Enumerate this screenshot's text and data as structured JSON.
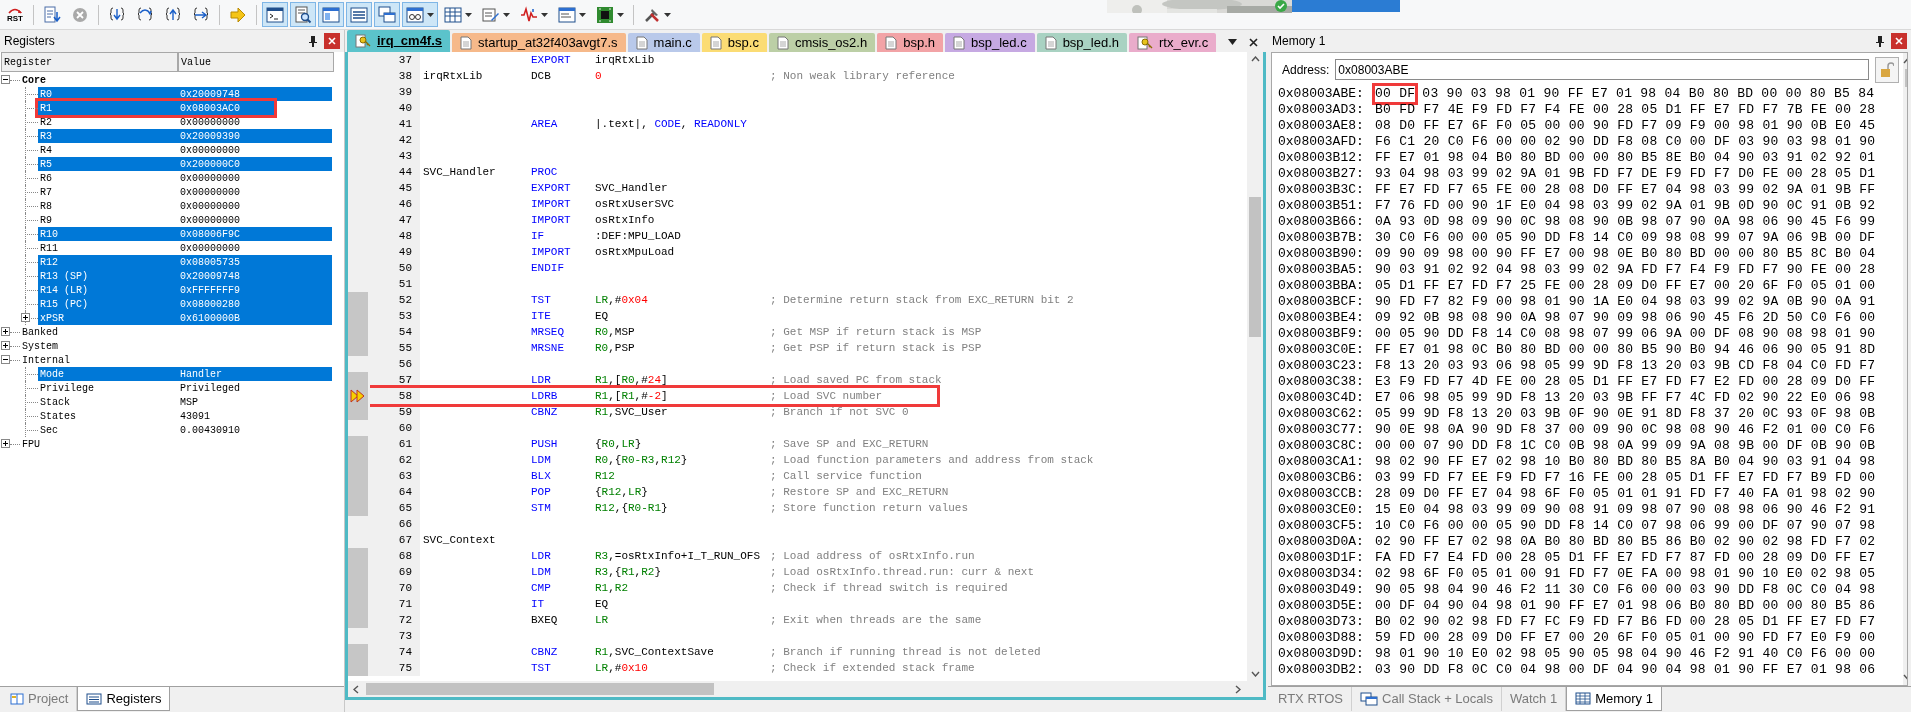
{
  "toolbar": [
    {
      "kind": "reset",
      "label": "RST",
      "on": false,
      "dropdown": false
    },
    {
      "kind": "separator"
    },
    {
      "kind": "run",
      "on": false,
      "dropdown": false
    },
    {
      "kind": "stop",
      "on": false,
      "dropdown": false
    },
    {
      "kind": "separator"
    },
    {
      "kind": "step-in",
      "on": false,
      "dropdown": false
    },
    {
      "kind": "step-over",
      "on": false,
      "dropdown": false
    },
    {
      "kind": "step-out",
      "on": false,
      "dropdown": false
    },
    {
      "kind": "run-to-cursor",
      "on": false,
      "dropdown": false
    },
    {
      "kind": "separator"
    },
    {
      "kind": "show-next",
      "on": false,
      "dropdown": false
    },
    {
      "kind": "separator"
    },
    {
      "kind": "command",
      "on": true,
      "dropdown": false
    },
    {
      "kind": "disassembly",
      "on": true,
      "dropdown": false
    },
    {
      "kind": "symbols",
      "on": true,
      "dropdown": false
    },
    {
      "kind": "registers",
      "on": true,
      "dropdown": false
    },
    {
      "kind": "call-stack",
      "on": true,
      "dropdown": false
    },
    {
      "kind": "watch",
      "on": true,
      "dropdown": true
    },
    {
      "kind": "memory",
      "on": false,
      "dropdown": true
    },
    {
      "kind": "serial",
      "on": false,
      "dropdown": true
    },
    {
      "kind": "analysis",
      "on": false,
      "dropdown": true
    },
    {
      "kind": "trace",
      "on": false,
      "dropdown": true
    },
    {
      "kind": "system-viewer",
      "on": false,
      "dropdown": true
    },
    {
      "kind": "separator"
    },
    {
      "kind": "toolbox",
      "on": false,
      "dropdown": true
    }
  ],
  "registers": {
    "title": "Registers",
    "columns": [
      "Register",
      "Value"
    ],
    "tree": [
      {
        "name": "Core",
        "expanded": true,
        "emphasized": true,
        "children": [
          {
            "name": "R0",
            "value": "0x20009748",
            "changed": true,
            "framed": false
          },
          {
            "name": "R1",
            "value": "0x08003AC0",
            "changed": true,
            "framed": true
          },
          {
            "name": "R2",
            "value": "0x00000000",
            "changed": false,
            "framed": false
          },
          {
            "name": "R3",
            "value": "0x20009390",
            "changed": true,
            "framed": false
          },
          {
            "name": "R4",
            "value": "0x00000000",
            "changed": false,
            "framed": false
          },
          {
            "name": "R5",
            "value": "0x200000C0",
            "changed": true,
            "framed": false
          },
          {
            "name": "R6",
            "value": "0x00000000",
            "changed": false,
            "framed": false
          },
          {
            "name": "R7",
            "value": "0x00000000",
            "changed": false,
            "framed": false
          },
          {
            "name": "R8",
            "value": "0x00000000",
            "changed": false,
            "framed": false
          },
          {
            "name": "R9",
            "value": "0x00000000",
            "changed": false,
            "framed": false
          },
          {
            "name": "R10",
            "value": "0x08006F9C",
            "changed": true,
            "framed": false
          },
          {
            "name": "R11",
            "value": "0x00000000",
            "changed": false,
            "framed": false
          },
          {
            "name": "R12",
            "value": "0x08005735",
            "changed": true,
            "framed": false
          },
          {
            "name": "R13 (SP)",
            "value": "0x20009748",
            "changed": true,
            "framed": false
          },
          {
            "name": "R14 (LR)",
            "value": "0xFFFFFFF9",
            "changed": true,
            "framed": false
          },
          {
            "name": "R15 (PC)",
            "value": "0x08000280",
            "changed": true,
            "framed": false
          },
          {
            "name": "xPSR",
            "value": "0x6100000B",
            "changed": true,
            "framed": false,
            "expanded": false
          }
        ]
      },
      {
        "name": "Banked",
        "expanded": false,
        "emphasized": false
      },
      {
        "name": "System",
        "expanded": false,
        "emphasized": false
      },
      {
        "name": "Internal",
        "expanded": true,
        "emphasized": false,
        "children": [
          {
            "name": "Mode",
            "value": "Handler",
            "changed": true,
            "framed": false
          },
          {
            "name": "Privilege",
            "value": "Privileged",
            "changed": false,
            "framed": false
          },
          {
            "name": "Stack",
            "value": "MSP",
            "changed": false,
            "framed": false
          },
          {
            "name": "States",
            "value": "43091",
            "changed": false,
            "framed": false
          },
          {
            "name": "Sec",
            "value": "0.00430910",
            "changed": false,
            "framed": false
          }
        ]
      },
      {
        "name": "FPU",
        "expanded": false,
        "emphasized": false
      }
    ],
    "tabs": [
      {
        "label": "Project",
        "kind": "book",
        "selected": false
      },
      {
        "label": "Registers",
        "kind": "list",
        "selected": true
      }
    ]
  },
  "editor": {
    "tabs": [
      {
        "label": "irq_cm4f.s",
        "kind": "key",
        "color": "#5bc3cb",
        "selected": true
      },
      {
        "label": "startup_at32f403avgt7.s",
        "kind": "doc",
        "color": "#f6b98a",
        "selected": false
      },
      {
        "label": "main.c",
        "kind": "doc",
        "color": "#b9c9ea",
        "selected": false
      },
      {
        "label": "bsp.c",
        "kind": "doc",
        "color": "#fbdc74",
        "selected": false
      },
      {
        "label": "cmsis_os2.h",
        "kind": "doc",
        "color": "#bccfa6",
        "selected": false
      },
      {
        "label": "bsp.h",
        "kind": "doc",
        "color": "#f2a3a6",
        "selected": false
      },
      {
        "label": "bsp_led.c",
        "kind": "doc",
        "color": "#c6a9e2",
        "selected": false
      },
      {
        "label": "bsp_led.h",
        "kind": "doc",
        "color": "#a9d2c2",
        "selected": false
      },
      {
        "label": "rtx_evr.c",
        "kind": "key",
        "color": "#eaaccb",
        "selected": false
      }
    ],
    "lines": [
      {
        "n": "37",
        "op": "EXPORT",
        "op_kw": true,
        "args": [
          {
            "t": "irqRtxLib",
            "kind": "plain"
          }
        ],
        "executable": false,
        "current": false,
        "framed": false
      },
      {
        "n": "38",
        "label": "irqRtxLib",
        "op": "DCB",
        "op_kw": false,
        "args": [
          {
            "t": "0",
            "kind": "num"
          }
        ],
        "comment": "; Non weak library reference",
        "executable": false,
        "current": false,
        "framed": false
      },
      {
        "n": "39",
        "executable": false,
        "current": false,
        "framed": false
      },
      {
        "n": "40",
        "executable": false,
        "current": false,
        "framed": false
      },
      {
        "n": "41",
        "op": "AREA",
        "op_kw": true,
        "args": [
          {
            "t": "|.text|, ",
            "kind": "plain"
          },
          {
            "t": "CODE",
            "kind": "kw"
          },
          {
            "t": ", ",
            "kind": "plain"
          },
          {
            "t": "READONLY",
            "kind": "kw"
          }
        ],
        "executable": false,
        "current": false,
        "framed": false
      },
      {
        "n": "42",
        "executable": false,
        "current": false,
        "framed": false
      },
      {
        "n": "43",
        "executable": false,
        "current": false,
        "framed": false
      },
      {
        "n": "44",
        "label": "SVC_Handler",
        "op": "PROC",
        "op_kw": true,
        "executable": false,
        "current": false,
        "framed": false
      },
      {
        "n": "45",
        "op": "EXPORT",
        "op_kw": true,
        "args": [
          {
            "t": "SVC_Handler",
            "kind": "plain"
          }
        ],
        "executable": false,
        "current": false,
        "framed": false
      },
      {
        "n": "46",
        "op": "IMPORT",
        "op_kw": true,
        "args": [
          {
            "t": "osRtxUserSVC",
            "kind": "plain"
          }
        ],
        "executable": false,
        "current": false,
        "framed": false
      },
      {
        "n": "47",
        "op": "IMPORT",
        "op_kw": true,
        "args": [
          {
            "t": "osRtxInfo",
            "kind": "plain"
          }
        ],
        "executable": false,
        "current": false,
        "framed": false
      },
      {
        "n": "48",
        "op": "IF",
        "op_kw": true,
        "args": [
          {
            "t": ":DEF:MPU_LOAD",
            "kind": "plain"
          }
        ],
        "executable": false,
        "current": false,
        "framed": false
      },
      {
        "n": "49",
        "op": "IMPORT",
        "op_kw": true,
        "args": [
          {
            "t": "osRtxMpuLoad",
            "kind": "plain"
          }
        ],
        "executable": false,
        "current": false,
        "framed": false
      },
      {
        "n": "50",
        "op": "ENDIF",
        "op_kw": true,
        "executable": false,
        "current": false,
        "framed": false
      },
      {
        "n": "51",
        "executable": false,
        "current": false,
        "framed": false
      },
      {
        "n": "52",
        "op": "TST",
        "op_kw": true,
        "args": [
          {
            "t": "LR",
            "kind": "reg"
          },
          {
            "t": ",#",
            "kind": "plain"
          },
          {
            "t": "0x04",
            "kind": "num"
          }
        ],
        "comment": "; Determine return stack from EXC_RETURN bit 2",
        "executable": true,
        "current": false,
        "framed": false
      },
      {
        "n": "53",
        "op": "ITE",
        "op_kw": true,
        "args": [
          {
            "t": "EQ",
            "kind": "plain"
          }
        ],
        "executable": true,
        "current": false,
        "framed": false
      },
      {
        "n": "54",
        "op": "MRSEQ",
        "op_kw": true,
        "args": [
          {
            "t": "R0",
            "kind": "reg"
          },
          {
            "t": ",MSP",
            "kind": "plain"
          }
        ],
        "comment": "; Get MSP if return stack is MSP",
        "executable": true,
        "current": false,
        "framed": false
      },
      {
        "n": "55",
        "op": "MRSNE",
        "op_kw": true,
        "args": [
          {
            "t": "R0",
            "kind": "reg"
          },
          {
            "t": ",PSP",
            "kind": "plain"
          }
        ],
        "comment": "; Get PSP if return stack is PSP",
        "executable": true,
        "current": false,
        "framed": false
      },
      {
        "n": "56",
        "executable": false,
        "current": false,
        "framed": false
      },
      {
        "n": "57",
        "op": "LDR",
        "op_kw": true,
        "args": [
          {
            "t": "R1",
            "kind": "reg"
          },
          {
            "t": ",[",
            "kind": "plain"
          },
          {
            "t": "R0",
            "kind": "reg"
          },
          {
            "t": ",#",
            "kind": "plain"
          },
          {
            "t": "24",
            "kind": "num"
          },
          {
            "t": "]",
            "kind": "plain"
          }
        ],
        "comment": "; Load saved PC from stack",
        "executable": true,
        "current": false,
        "framed": false
      },
      {
        "n": "58",
        "op": "LDRB",
        "op_kw": true,
        "args": [
          {
            "t": "R1",
            "kind": "reg"
          },
          {
            "t": ",[",
            "kind": "plain"
          },
          {
            "t": "R1",
            "kind": "reg"
          },
          {
            "t": ",#",
            "kind": "plain"
          },
          {
            "t": "-2",
            "kind": "num"
          },
          {
            "t": "]",
            "kind": "plain"
          }
        ],
        "comment": "; Load SVC number",
        "executable": true,
        "current": true,
        "framed": true
      },
      {
        "n": "59",
        "op": "CBNZ",
        "op_kw": true,
        "args": [
          {
            "t": "R1",
            "kind": "reg"
          },
          {
            "t": ",SVC_User",
            "kind": "plain"
          }
        ],
        "comment": "; Branch if not SVC 0",
        "executable": true,
        "current": false,
        "framed": false
      },
      {
        "n": "60",
        "executable": false,
        "current": false,
        "framed": false
      },
      {
        "n": "61",
        "op": "PUSH",
        "op_kw": true,
        "args": [
          {
            "t": "{",
            "kind": "plain"
          },
          {
            "t": "R0",
            "kind": "reg"
          },
          {
            "t": ",",
            "kind": "plain"
          },
          {
            "t": "LR",
            "kind": "reg"
          },
          {
            "t": "}",
            "kind": "plain"
          }
        ],
        "comment": "; Save SP and EXC_RETURN",
        "executable": true,
        "current": false,
        "framed": false
      },
      {
        "n": "62",
        "op": "LDM",
        "op_kw": true,
        "args": [
          {
            "t": "R0",
            "kind": "reg"
          },
          {
            "t": ",{",
            "kind": "plain"
          },
          {
            "t": "R0-R3",
            "kind": "reg"
          },
          {
            "t": ",",
            "kind": "plain"
          },
          {
            "t": "R12",
            "kind": "reg"
          },
          {
            "t": "}",
            "kind": "plain"
          }
        ],
        "comment": "; Load function parameters and address from stack",
        "executable": true,
        "current": false,
        "framed": false
      },
      {
        "n": "63",
        "op": "BLX",
        "op_kw": true,
        "args": [
          {
            "t": "R12",
            "kind": "reg"
          }
        ],
        "comment": "; Call service function",
        "executable": true,
        "current": false,
        "framed": false
      },
      {
        "n": "64",
        "op": "POP",
        "op_kw": true,
        "args": [
          {
            "t": "{",
            "kind": "plain"
          },
          {
            "t": "R12",
            "kind": "reg"
          },
          {
            "t": ",",
            "kind": "plain"
          },
          {
            "t": "LR",
            "kind": "reg"
          },
          {
            "t": "}",
            "kind": "plain"
          }
        ],
        "comment": "; Restore SP and EXC_RETURN",
        "executable": true,
        "current": false,
        "framed": false
      },
      {
        "n": "65",
        "op": "STM",
        "op_kw": true,
        "args": [
          {
            "t": "R12",
            "kind": "reg"
          },
          {
            "t": ",{",
            "kind": "plain"
          },
          {
            "t": "R0-R1",
            "kind": "reg"
          },
          {
            "t": "}",
            "kind": "plain"
          }
        ],
        "comment": "; Store function return values",
        "executable": true,
        "current": false,
        "framed": false
      },
      {
        "n": "66",
        "executable": false,
        "current": false,
        "framed": false
      },
      {
        "n": "67",
        "label": "SVC_Context",
        "executable": false,
        "current": false,
        "framed": false
      },
      {
        "n": "68",
        "op": "LDR",
        "op_kw": true,
        "args": [
          {
            "t": "R3",
            "kind": "reg"
          },
          {
            "t": ",=osRtxInfo+I_T_RUN_OFS",
            "kind": "plain"
          }
        ],
        "comment": "; Load address of osRtxInfo.run",
        "executable": true,
        "current": false,
        "framed": false
      },
      {
        "n": "69",
        "op": "LDM",
        "op_kw": true,
        "args": [
          {
            "t": "R3",
            "kind": "reg"
          },
          {
            "t": ",{",
            "kind": "plain"
          },
          {
            "t": "R1",
            "kind": "reg"
          },
          {
            "t": ",",
            "kind": "plain"
          },
          {
            "t": "R2",
            "kind": "reg"
          },
          {
            "t": "}",
            "kind": "plain"
          }
        ],
        "comment": "; Load osRtxInfo.thread.run: curr & next",
        "executable": true,
        "current": false,
        "framed": false
      },
      {
        "n": "70",
        "op": "CMP",
        "op_kw": true,
        "args": [
          {
            "t": "R1",
            "kind": "reg"
          },
          {
            "t": ",",
            "kind": "plain"
          },
          {
            "t": "R2",
            "kind": "reg"
          }
        ],
        "comment": "; Check if thread switch is required",
        "executable": true,
        "current": false,
        "framed": false
      },
      {
        "n": "71",
        "op": "IT",
        "op_kw": true,
        "args": [
          {
            "t": "EQ",
            "kind": "plain"
          }
        ],
        "executable": true,
        "current": false,
        "framed": false
      },
      {
        "n": "72",
        "op": "BXEQ",
        "op_kw": false,
        "args": [
          {
            "t": "LR",
            "kind": "reg"
          }
        ],
        "comment": "; Exit when threads are the same",
        "executable": true,
        "current": false,
        "framed": false
      },
      {
        "n": "73",
        "executable": false,
        "current": false,
        "framed": false
      },
      {
        "n": "74",
        "op": "CBNZ",
        "op_kw": true,
        "args": [
          {
            "t": "R1",
            "kind": "reg"
          },
          {
            "t": ",SVC_ContextSave",
            "kind": "plain"
          }
        ],
        "comment": "; Branch if running thread is not deleted",
        "executable": true,
        "current": false,
        "framed": false
      },
      {
        "n": "75",
        "op": "TST",
        "op_kw": true,
        "args": [
          {
            "t": "LR",
            "kind": "reg"
          },
          {
            "t": ",#",
            "kind": "plain"
          },
          {
            "t": "0x10",
            "kind": "num"
          }
        ],
        "comment": "; Check if extended stack frame",
        "executable": true,
        "current": false,
        "framed": false
      }
    ]
  },
  "memory": {
    "title": "Memory 1",
    "address_label": "Address:",
    "address": "0x08003ABE",
    "rows": [
      {
        "addr": "0x08003ABE:",
        "framed": "00 DF",
        "bytes": "03 90 03 98 01 90 FF E7 01 98 04 B0 80 BD 00 00 80 B5 84"
      },
      {
        "addr": "0x08003AD3:",
        "bytes": "B0 FD F7 4E F9 FD F7 F4 FE 00 28 05 D1 FF E7 FD F7 7B FE 00 28"
      },
      {
        "addr": "0x08003AE8:",
        "bytes": "08 D0 FF E7 6F F0 05 00 00 90 FD F7 09 F9 00 98 01 90 0B E0 45"
      },
      {
        "addr": "0x08003AFD:",
        "bytes": "F6 C1 20 C0 F6 00 00 02 90 DD F8 08 C0 00 DF 03 90 03 98 01 90"
      },
      {
        "addr": "0x08003B12:",
        "bytes": "FF E7 01 98 04 B0 80 BD 00 00 80 B5 8E B0 04 90 03 91 02 92 01"
      },
      {
        "addr": "0x08003B27:",
        "bytes": "93 04 98 03 99 02 9A 01 9B FD F7 DE F9 FD F7 D0 FE 00 28 05 D1"
      },
      {
        "addr": "0x08003B3C:",
        "bytes": "FF E7 FD F7 65 FE 00 28 08 D0 FF E7 04 98 03 99 02 9A 01 9B FF"
      },
      {
        "addr": "0x08003B51:",
        "bytes": "F7 76 FD 00 90 1F E0 04 98 03 99 02 9A 01 9B 0D 90 0C 91 0B 92"
      },
      {
        "addr": "0x08003B66:",
        "bytes": "0A 93 0D 98 09 90 0C 98 08 90 0B 98 07 90 0A 98 06 90 45 F6 99"
      },
      {
        "addr": "0x08003B7B:",
        "bytes": "30 C0 F6 00 00 05 90 DD F8 14 C0 09 98 08 99 07 9A 06 9B 00 DF"
      },
      {
        "addr": "0x08003B90:",
        "bytes": "09 90 09 98 00 90 FF E7 00 98 0E B0 80 BD 00 00 80 B5 8C B0 04"
      },
      {
        "addr": "0x08003BA5:",
        "bytes": "90 03 91 02 92 04 98 03 99 02 9A FD F7 F4 F9 FD F7 90 FE 00 28"
      },
      {
        "addr": "0x08003BBA:",
        "bytes": "05 D1 FF E7 FD F7 25 FE 00 28 09 D0 FF E7 00 20 6F F0 05 01 00"
      },
      {
        "addr": "0x08003BCF:",
        "bytes": "90 FD F7 82 F9 00 98 01 90 1A E0 04 98 03 99 02 9A 0B 90 0A 91"
      },
      {
        "addr": "0x08003BE4:",
        "bytes": "09 92 0B 98 08 90 0A 98 07 90 09 98 06 90 45 F6 2D 50 C0 F6 00"
      },
      {
        "addr": "0x08003BF9:",
        "bytes": "00 05 90 DD F8 14 C0 08 98 07 99 06 9A 00 DF 08 90 08 98 01 90"
      },
      {
        "addr": "0x08003C0E:",
        "bytes": "FF E7 01 98 0C B0 80 BD 00 00 80 B5 90 B0 94 46 06 90 05 91 8D"
      },
      {
        "addr": "0x08003C23:",
        "bytes": "F8 13 20 03 93 06 98 05 99 9D F8 13 20 03 9B CD F8 04 C0 FD F7"
      },
      {
        "addr": "0x08003C38:",
        "bytes": "E3 F9 FD F7 4D FE 00 28 05 D1 FF E7 FD F7 E2 FD 00 28 09 D0 FF"
      },
      {
        "addr": "0x08003C4D:",
        "bytes": "E7 06 98 05 99 9D F8 13 20 03 9B FF F7 4C FD 02 90 22 E0 06 98"
      },
      {
        "addr": "0x08003C62:",
        "bytes": "05 99 9D F8 13 20 03 9B 0F 90 0E 91 8D F8 37 20 0C 93 0F 98 0B"
      },
      {
        "addr": "0x08003C77:",
        "bytes": "90 0E 98 0A 90 9D F8 37 00 09 90 0C 98 08 90 46 F2 01 00 C0 F6"
      },
      {
        "addr": "0x08003C8C:",
        "bytes": "00 00 07 90 DD F8 1C C0 0B 98 0A 99 09 9A 08 9B 00 DF 0B 90 0B"
      },
      {
        "addr": "0x08003CA1:",
        "bytes": "98 02 90 FF E7 02 98 10 B0 80 BD 80 B5 8A B0 04 90 03 91 04 98"
      },
      {
        "addr": "0x08003CB6:",
        "bytes": "03 99 FD F7 EE F9 FD F7 16 FE 00 28 05 D1 FF E7 FD F7 B9 FD 00"
      },
      {
        "addr": "0x08003CCB:",
        "bytes": "28 09 D0 FF E7 04 98 6F F0 05 01 01 91 FD F7 40 FA 01 98 02 90"
      },
      {
        "addr": "0x08003CE0:",
        "bytes": "15 E0 04 98 03 99 09 90 08 91 09 98 07 90 08 98 06 90 46 F2 91"
      },
      {
        "addr": "0x08003CF5:",
        "bytes": "10 C0 F6 00 00 05 90 DD F8 14 C0 07 98 06 99 00 DF 07 90 07 98"
      },
      {
        "addr": "0x08003D0A:",
        "bytes": "02 90 FF E7 02 98 0A B0 80 BD 80 B5 86 B0 02 90 02 98 FD F7 02"
      },
      {
        "addr": "0x08003D1F:",
        "bytes": "FA FD F7 E4 FD 00 28 05 D1 FF E7 FD F7 87 FD 00 28 09 D0 FF E7"
      },
      {
        "addr": "0x08003D34:",
        "bytes": "02 98 6F F0 05 01 00 91 FD F7 0E FA 00 98 01 90 10 E0 02 98 05"
      },
      {
        "addr": "0x08003D49:",
        "bytes": "90 05 98 04 90 46 F2 11 30 C0 F6 00 00 03 90 DD F8 0C C0 04 98"
      },
      {
        "addr": "0x08003D5E:",
        "bytes": "00 DF 04 90 04 98 01 90 FF E7 01 98 06 B0 80 BD 00 00 80 B5 86"
      },
      {
        "addr": "0x08003D73:",
        "bytes": "B0 02 90 02 98 FD F7 FC F9 FD F7 B6 FD 00 28 05 D1 FF E7 FD F7"
      },
      {
        "addr": "0x08003D88:",
        "bytes": "59 FD 00 28 09 D0 FF E7 00 20 6F F0 05 01 00 90 FD F7 E0 F9 00"
      },
      {
        "addr": "0x08003D9D:",
        "bytes": "98 01 90 10 E0 02 98 05 90 05 98 04 90 46 F2 91 40 C0 F6 00 00"
      },
      {
        "addr": "0x08003DB2:",
        "bytes": "03 90 DD F8 0C C0 04 98 00 DF 04 90 04 98 01 90 FF E7 01 98 06"
      }
    ],
    "tabs": [
      {
        "label": "RTX RTOS",
        "kind": "none",
        "selected": false
      },
      {
        "label": "Call Stack + Locals",
        "kind": "stack",
        "selected": false
      },
      {
        "label": "Watch 1",
        "kind": "none",
        "selected": false
      },
      {
        "label": "Memory 1",
        "kind": "grid",
        "selected": true
      }
    ]
  }
}
